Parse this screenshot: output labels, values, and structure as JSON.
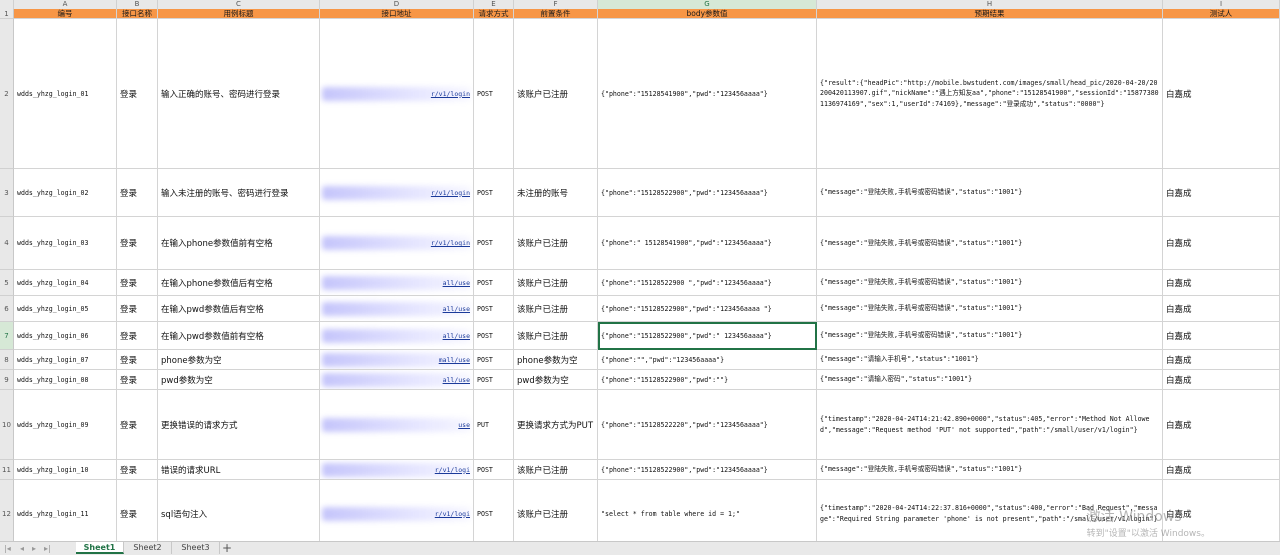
{
  "columns": [
    "A",
    "B",
    "C",
    "D",
    "E",
    "F",
    "G",
    "H",
    "I"
  ],
  "selected_column": "G",
  "selected_row": "7",
  "header": [
    "编号",
    "接口名称",
    "用例标题",
    "接口地址",
    "请求方式",
    "前置条件",
    "body参数值",
    "预期结果",
    "测试人"
  ],
  "rows": [
    {
      "num": "2",
      "id": "wdds_yhzg_login_01",
      "name": "登录",
      "title": "输入正确的账号、密码进行登录",
      "url": "r/v1/login",
      "method": "POST",
      "pre": "该账户已注册",
      "body": "{\"phone\":\"15128541900\",\"pwd\":\"123456aaaa\"}",
      "expect": "{\"result\":{\"headPic\":\"http://mobile.bwstudent.com/images/small/head_pic/2020-04-20/20200420113907.gif\",\"nickName\":\"遇上方知友aa\",\"phone\":\"15128541900\",\"sessionId\":\"158773801136974169\",\"sex\":1,\"userId\":74169},\"message\":\"登录成功\",\"status\":\"0000\"}",
      "tester": "白嘉成"
    },
    {
      "num": "3",
      "id": "wdds_yhzg_login_02",
      "name": "登录",
      "title": "输入未注册的账号、密码进行登录",
      "url": "r/v1/login",
      "method": "POST",
      "pre": "未注册的账号",
      "body": "{\"phone\":\"15128522900\",\"pwd\":\"123456aaaa\"}",
      "expect": "{\"message\":\"登陆失败,手机号或密码错误\",\"status\":\"1001\"}",
      "tester": "白嘉成"
    },
    {
      "num": "4",
      "id": "wdds_yhzg_login_03",
      "name": "登录",
      "title": "在输入phone参数值前有空格",
      "url": "r/v1/login",
      "method": "POST",
      "pre": "该账户已注册",
      "body": "{\"phone\":\"  15128541900\",\"pwd\":\"123456aaaa\"}",
      "expect": "{\"message\":\"登陆失败,手机号或密码错误\",\"status\":\"1001\"}",
      "tester": "白嘉成"
    },
    {
      "num": "5",
      "id": "wdds_yhzg_login_04",
      "name": "登录",
      "title": "在输入phone参数值后有空格",
      "url": "all/use",
      "method": "POST",
      "pre": "该账户已注册",
      "body": "{\"phone\":\"15128522900 \",\"pwd\":\"123456aaaa\"}",
      "expect": "{\"message\":\"登陆失败,手机号或密码错误\",\"status\":\"1001\"}",
      "tester": "白嘉成"
    },
    {
      "num": "6",
      "id": "wdds_yhzg_login_05",
      "name": "登录",
      "title": "在输入pwd参数值后有空格",
      "url": "all/use",
      "method": "POST",
      "pre": "该账户已注册",
      "body": "{\"phone\":\"15128522900\",\"pwd\":\"123456aaaa \"}",
      "expect": "{\"message\":\"登陆失败,手机号或密码错误\",\"status\":\"1001\"}",
      "tester": "白嘉成"
    },
    {
      "num": "7",
      "id": "wdds_yhzg_login_06",
      "name": "登录",
      "title": "在输入pwd参数值前有空格",
      "url": "all/use",
      "method": "POST",
      "pre": "该账户已注册",
      "body": "{\"phone\":\"15128522900\",\"pwd\":\"  123456aaaa\"}",
      "expect": "{\"message\":\"登陆失败,手机号或密码错误\",\"status\":\"1001\"}",
      "tester": "白嘉成"
    },
    {
      "num": "8",
      "id": "wdds_yhzg_login_07",
      "name": "登录",
      "title": "phone参数为空",
      "url": "mall/use",
      "method": "POST",
      "pre": "phone参数为空",
      "body": "{\"phone\":\"\",\"pwd\":\"123456aaaa\"}",
      "expect": "{\"message\":\"请输入手机号\",\"status\":\"1001\"}",
      "tester": "白嘉成"
    },
    {
      "num": "9",
      "id": "wdds_yhzg_login_08",
      "name": "登录",
      "title": "pwd参数为空",
      "url": "all/use",
      "method": "POST",
      "pre": "pwd参数为空",
      "body": "{\"phone\":\"15128522900\",\"pwd\":\"\"}",
      "expect": "{\"message\":\"请输入密码\",\"status\":\"1001\"}",
      "tester": "白嘉成"
    },
    {
      "num": "10",
      "id": "wdds_yhzg_login_09",
      "name": "登录",
      "title": "更换错误的请求方式",
      "url": "use",
      "method": "PUT",
      "pre": "更换请求方式为PUT",
      "body": "{\"phone\":\"15128522220\",\"pwd\":\"123456aaaa\"}",
      "expect": "{\"timestamp\":\"2020-04-24T14:21:42.890+0000\",\"status\":405,\"error\":\"Method Not Allowed\",\"message\":\"Request method 'PUT' not supported\",\"path\":\"/small/user/v1/login\"}",
      "tester": "白嘉成"
    },
    {
      "num": "11",
      "id": "wdds_yhzg_login_10",
      "name": "登录",
      "title": "错误的请求URL",
      "url": "r/v1/logi",
      "method": "POST",
      "pre": "该账户已注册",
      "body": "{\"phone\":\"15128522900\",\"pwd\":\"123456aaaa\"}",
      "expect": "{\"message\":\"登陆失败,手机号或密码错误\",\"status\":\"1001\"}",
      "tester": "白嘉成"
    },
    {
      "num": "12",
      "id": "wdds_yhzg_login_11",
      "name": "登录",
      "title": "sql语句注入",
      "url": "r/v1/logi",
      "method": "POST",
      "pre": "该账户已注册",
      "body": "\"select * from table where id = 1;\"",
      "expect": "{\"timestamp\":\"2020-04-24T14:22:37.816+0000\",\"status\":400,\"error\":\"Bad Request\",\"message\":\"Required String parameter 'phone' is not present\",\"path\":\"/small/user/v1/login\"}",
      "tester": "白嘉成"
    }
  ],
  "sheets": [
    "Sheet1",
    "Sheet2",
    "Sheet3"
  ],
  "active_sheet": "Sheet1",
  "add_sheet_label": "+",
  "watermark": {
    "line1": "激活 Windows",
    "line2": "转到\"设置\"以激活 Windows。"
  },
  "colors": {
    "header_bg": "#f79646",
    "selection": "#217346",
    "url": "#1a3a9a"
  }
}
